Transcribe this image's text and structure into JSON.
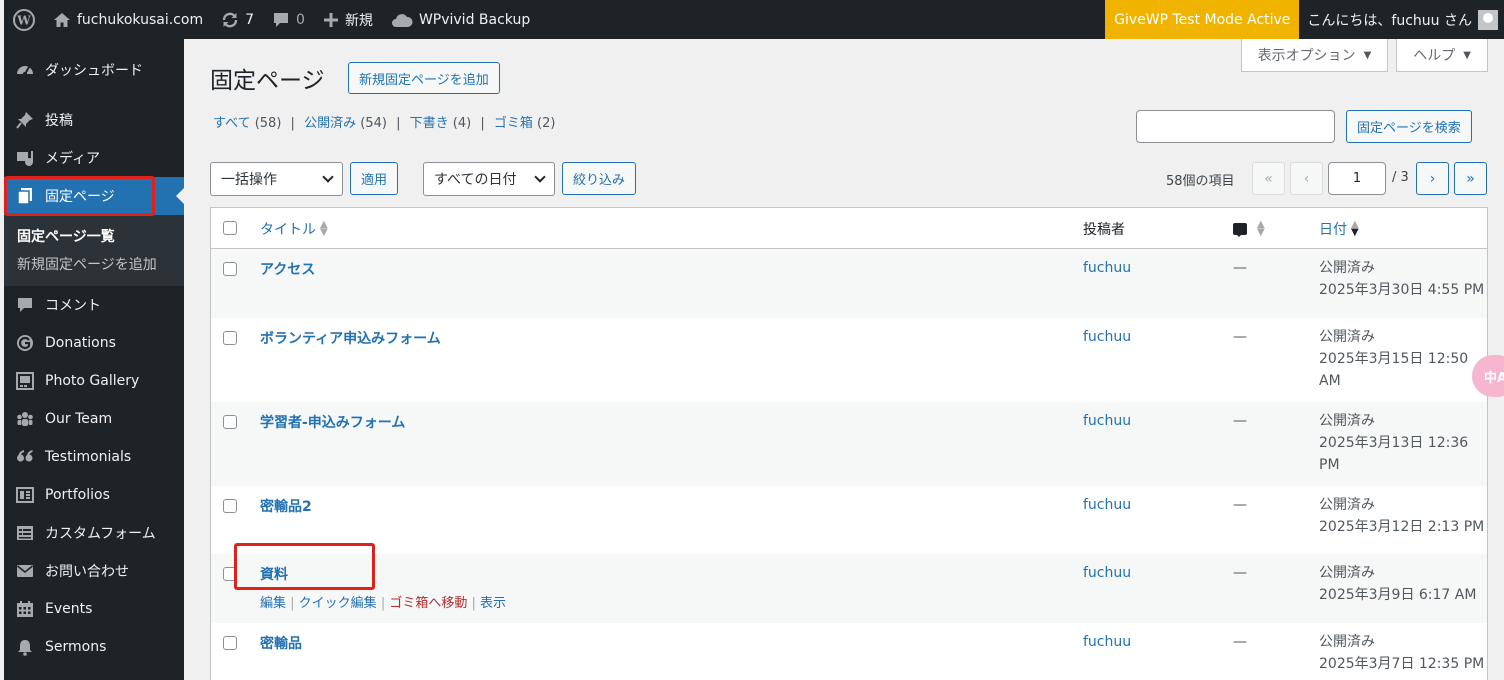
{
  "admin_bar": {
    "site_name": "fuchukokusai.com",
    "updates_count": "7",
    "comments_count": "0",
    "new_label": "新規",
    "wpvivid_label": "WPvivid Backup",
    "givewp_label": "GiveWP Test Mode Active",
    "howdy": "こんにちは、fuchuu さん",
    "colors": {
      "bar_bg": "#1d2327",
      "givewp_bg": "#f0b400"
    }
  },
  "sidebar": {
    "items_top": [
      {
        "label": "ダッシュボード",
        "icon": "dashboard-icon"
      }
    ],
    "items_mid": [
      {
        "label": "投稿",
        "icon": "pin-icon"
      },
      {
        "label": "メディア",
        "icon": "media-icon"
      }
    ],
    "current": {
      "label": "固定ページ",
      "icon": "pages-icon"
    },
    "submenu": [
      {
        "label": "固定ページ一覧",
        "current": true
      },
      {
        "label": "新規固定ページを追加",
        "current": false
      }
    ],
    "items_bottom": [
      {
        "label": "コメント",
        "icon": "comment-icon"
      },
      {
        "label": "Donations",
        "icon": "give-icon"
      },
      {
        "label": "Photo Gallery",
        "icon": "gallery-icon"
      },
      {
        "label": "Our Team",
        "icon": "groups-icon"
      },
      {
        "label": "Testimonials",
        "icon": "quote-icon"
      },
      {
        "label": "Portfolios",
        "icon": "portfolio-icon"
      },
      {
        "label": "カスタムフォーム",
        "icon": "form-icon"
      },
      {
        "label": "お問い合わせ",
        "icon": "mail-icon"
      },
      {
        "label": "Events",
        "icon": "calendar-icon"
      },
      {
        "label": "Sermons",
        "icon": "bell-icon"
      }
    ]
  },
  "screen_tabs": {
    "screen_options": "表示オプション",
    "help": "ヘルプ"
  },
  "page": {
    "title": "固定ページ",
    "add_new": "新規固定ページを追加",
    "search_button": "固定ページを検索",
    "search_value": ""
  },
  "filters": {
    "all": "すべて",
    "all_count": "(58)",
    "published": "公開済み",
    "published_count": "(54)",
    "drafts": "下書き",
    "drafts_count": "(4)",
    "trash": "ゴミ箱",
    "trash_count": "(2)"
  },
  "tablenav": {
    "bulk_action": "一括操作",
    "apply": "適用",
    "all_dates": "すべての日付",
    "filter": "絞り込み",
    "items_count": "58個の項目",
    "first": "«",
    "prev": "‹",
    "next": "›",
    "last": "»",
    "current_page": "1",
    "total_pages": "/ 3"
  },
  "table": {
    "headers": {
      "title": "タイトル",
      "author": "投稿者",
      "date": "日付"
    },
    "rows": [
      {
        "title": "アクセス",
        "author": "fuchuu",
        "comments": "—",
        "status": "公開済み",
        "date1": "2025年3月30日 4:55 PM",
        "date2": ""
      },
      {
        "title": "ボランティア申込みフォーム",
        "author": "fuchuu",
        "comments": "—",
        "status": "公開済み",
        "date1": "2025年3月15日 12:50",
        "date2": "AM"
      },
      {
        "title": "学習者-申込みフォーム",
        "author": "fuchuu",
        "comments": "—",
        "status": "公開済み",
        "date1": "2025年3月13日 12:36",
        "date2": "PM"
      },
      {
        "title": "密輸品2",
        "author": "fuchuu",
        "comments": "—",
        "status": "公開済み",
        "date1": "2025年3月12日 2:13 PM",
        "date2": ""
      },
      {
        "title": "資料",
        "author": "fuchuu",
        "comments": "—",
        "status": "公開済み",
        "date1": "2025年3月9日 6:17 AM",
        "date2": ""
      },
      {
        "title": "密輸品",
        "author": "fuchuu",
        "comments": "—",
        "status": "公開済み",
        "date1": "2025年3月7日 12:35 PM",
        "date2": ""
      }
    ],
    "row_actions": {
      "edit": "編集",
      "quick_edit": "クイック編集",
      "trash": "ゴミ箱へ移動",
      "view": "表示"
    }
  },
  "translate_fab": "中A"
}
